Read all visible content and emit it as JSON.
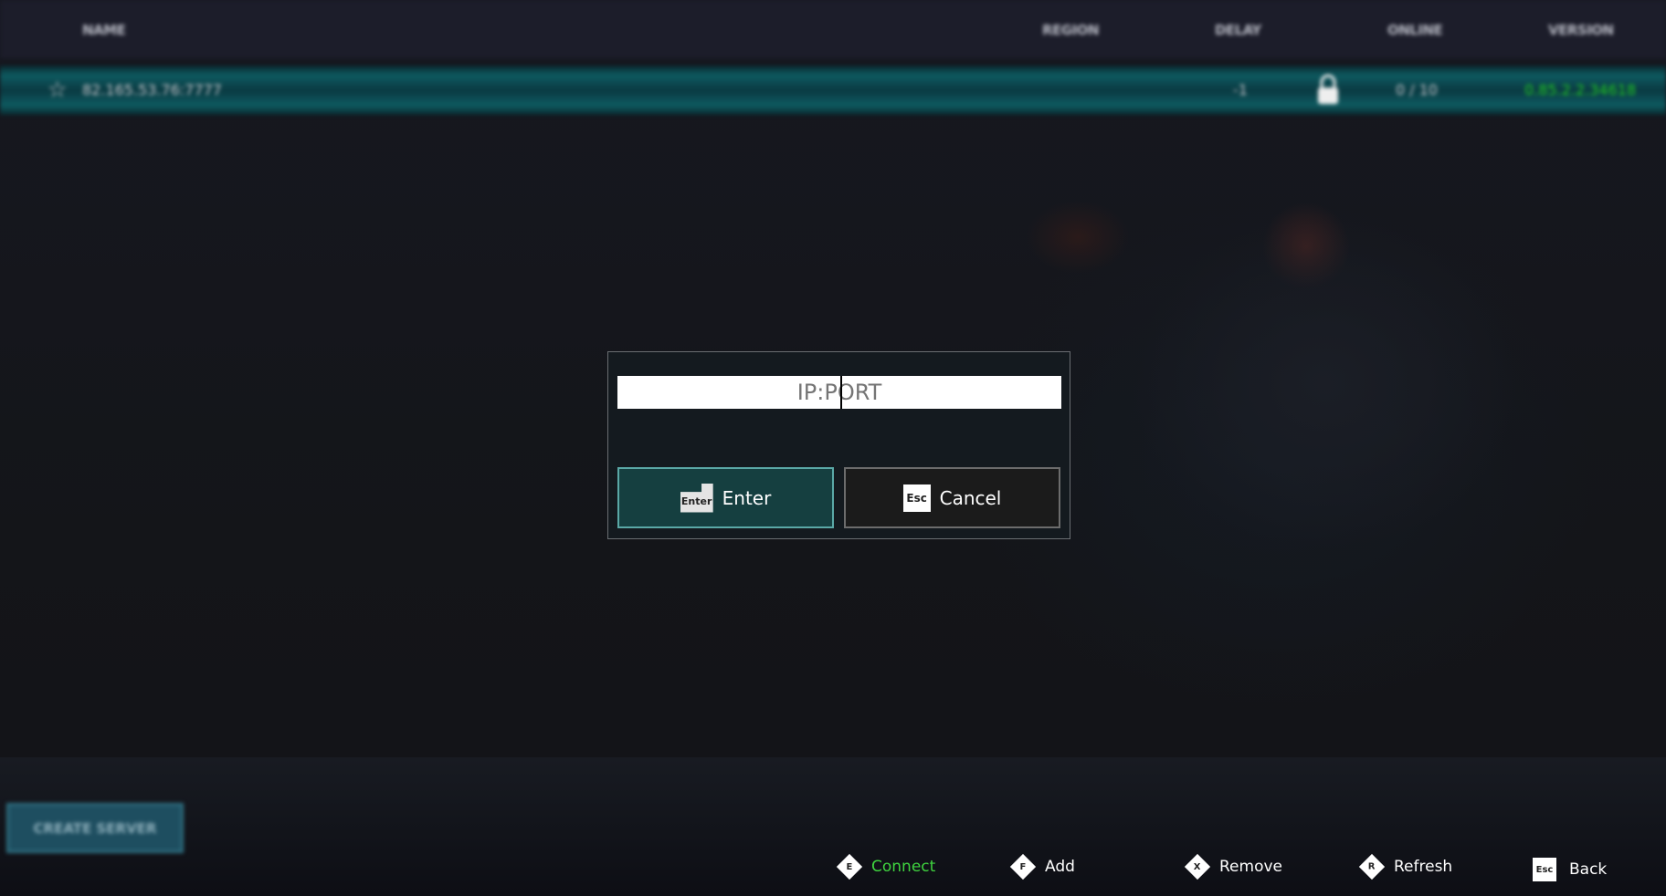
{
  "table": {
    "columns": {
      "name": "NAME",
      "region": "REGION",
      "delay": "DELAY",
      "online": "ONLINE",
      "version": "VERSION"
    },
    "rows": [
      {
        "name": "82.165.53.76:7777",
        "region": "",
        "delay": "-1",
        "locked": true,
        "online": "0 / 10",
        "version": "0.85.2.2.34618",
        "favorite_icon": "star-outline-icon"
      }
    ]
  },
  "create_server_label": "CREATE SERVER",
  "dialog": {
    "placeholder": "IP:PORT",
    "value": "",
    "enter_key": "Enter",
    "enter_label": "Enter",
    "cancel_key": "Esc",
    "cancel_label": "Cancel"
  },
  "footer": [
    {
      "key": "E",
      "label": "Connect"
    },
    {
      "key": "F",
      "label": "Add"
    },
    {
      "key": "X",
      "label": "Remove"
    },
    {
      "key": "R",
      "label": "Refresh"
    },
    {
      "key": "Esc",
      "label": "Back"
    }
  ],
  "colors": {
    "accent": "#1e8f8c",
    "version_green": "#22cc22",
    "connect_green": "#3fd33f"
  }
}
